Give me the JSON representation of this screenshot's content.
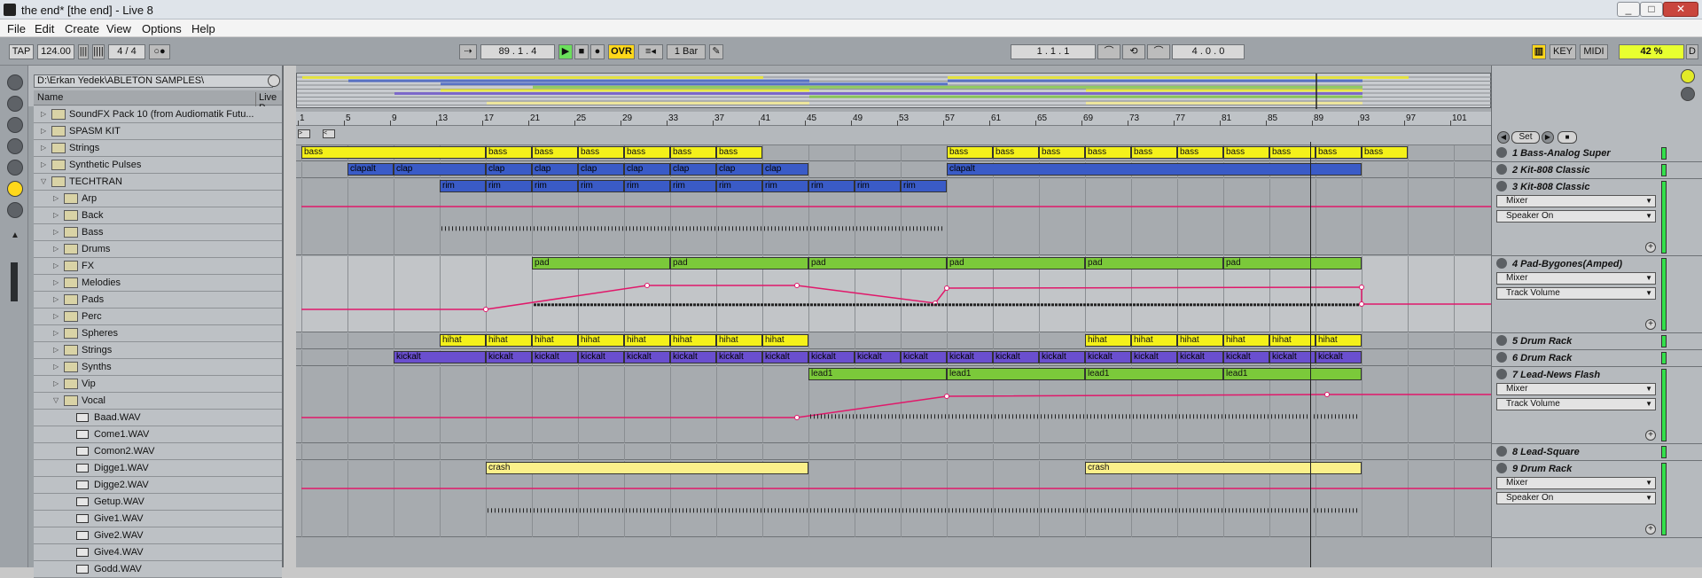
{
  "window": {
    "title": "the end*  [the end] - Live 8",
    "minimize": "_",
    "maximize": "□",
    "close": "✕"
  },
  "menu": [
    "File",
    "Edit",
    "Create",
    "View",
    "Options",
    "Help"
  ],
  "transport": {
    "tap": "TAP",
    "tempo": "124.00",
    "signature": "4 / 4",
    "follow": "○●",
    "position": "89 . 1 . 4",
    "ovr": "OVR",
    "quantize": "1 Bar",
    "loop_start": "1 . 1 . 1",
    "loop_length": "4 . 0 . 0",
    "key": "KEY",
    "midi": "MIDI",
    "cpu": "42 %",
    "d": "D"
  },
  "browser": {
    "path": "D:\\Erkan Yedek\\ABLETON SAMPLES\\",
    "col_name": "Name",
    "col_live": "Live P",
    "items": [
      {
        "label": "SoundFX Pack 10 (from Audiomatik Futu...",
        "indent": 1,
        "type": "folder",
        "open": false
      },
      {
        "label": "SPASM KIT",
        "indent": 1,
        "type": "folder",
        "open": false
      },
      {
        "label": "Strings",
        "indent": 1,
        "type": "folder",
        "open": false
      },
      {
        "label": "Synthetic Pulses",
        "indent": 1,
        "type": "folder",
        "open": false
      },
      {
        "label": "TECHTRAN",
        "indent": 1,
        "type": "folder",
        "open": true
      },
      {
        "label": "Arp",
        "indent": 2,
        "type": "folder",
        "open": false
      },
      {
        "label": "Back",
        "indent": 2,
        "type": "folder",
        "open": false
      },
      {
        "label": "Bass",
        "indent": 2,
        "type": "folder",
        "open": false
      },
      {
        "label": "Drums",
        "indent": 2,
        "type": "folder",
        "open": false
      },
      {
        "label": "FX",
        "indent": 2,
        "type": "folder",
        "open": false
      },
      {
        "label": "Melodies",
        "indent": 2,
        "type": "folder",
        "open": false
      },
      {
        "label": "Pads",
        "indent": 2,
        "type": "folder",
        "open": false
      },
      {
        "label": "Perc",
        "indent": 2,
        "type": "folder",
        "open": false
      },
      {
        "label": "Spheres",
        "indent": 2,
        "type": "folder",
        "open": false
      },
      {
        "label": "Strings",
        "indent": 2,
        "type": "folder",
        "open": false
      },
      {
        "label": "Synths",
        "indent": 2,
        "type": "folder",
        "open": false
      },
      {
        "label": "Vip",
        "indent": 2,
        "type": "folder",
        "open": false
      },
      {
        "label": "Vocal",
        "indent": 2,
        "type": "folder",
        "open": true
      },
      {
        "label": "Baad.WAV",
        "indent": 3,
        "type": "wav"
      },
      {
        "label": "Come1.WAV",
        "indent": 3,
        "type": "wav"
      },
      {
        "label": "Comon2.WAV",
        "indent": 3,
        "type": "wav"
      },
      {
        "label": "Digge1.WAV",
        "indent": 3,
        "type": "wav"
      },
      {
        "label": "Digge2.WAV",
        "indent": 3,
        "type": "wav"
      },
      {
        "label": "Getup.WAV",
        "indent": 3,
        "type": "wav"
      },
      {
        "label": "Give1.WAV",
        "indent": 3,
        "type": "wav"
      },
      {
        "label": "Give2.WAV",
        "indent": 3,
        "type": "wav"
      },
      {
        "label": "Give4.WAV",
        "indent": 3,
        "type": "wav"
      },
      {
        "label": "Godd.WAV",
        "indent": 3,
        "type": "wav"
      }
    ]
  },
  "ruler": [
    "1",
    "5",
    "9",
    "13",
    "17",
    "21",
    "25",
    "29",
    "33",
    "37",
    "41",
    "45",
    "49",
    "53",
    "57",
    "61",
    "65",
    "69",
    "73",
    "77",
    "81",
    "85",
    "89",
    "93",
    "97",
    "101"
  ],
  "locator": {
    "set": "Set"
  },
  "tracks": [
    {
      "name": "1 Bass-Analog Super",
      "color": "#f4f11a",
      "clips": [
        {
          "s": 1,
          "e": 17,
          "t": "bass"
        },
        {
          "s": 17,
          "e": 21,
          "t": "bass"
        },
        {
          "s": 21,
          "e": 25,
          "t": "bass"
        },
        {
          "s": 25,
          "e": 29,
          "t": "bass"
        },
        {
          "s": 29,
          "e": 33,
          "t": "bass"
        },
        {
          "s": 33,
          "e": 37,
          "t": "bass"
        },
        {
          "s": 37,
          "e": 41,
          "t": "bass"
        },
        {
          "s": 57,
          "e": 61,
          "t": "bass"
        },
        {
          "s": 61,
          "e": 65,
          "t": "bass"
        },
        {
          "s": 65,
          "e": 69,
          "t": "bass"
        },
        {
          "s": 69,
          "e": 73,
          "t": "bass"
        },
        {
          "s": 73,
          "e": 77,
          "t": "bass"
        },
        {
          "s": 77,
          "e": 81,
          "t": "bass"
        },
        {
          "s": 81,
          "e": 85,
          "t": "bass"
        },
        {
          "s": 85,
          "e": 89,
          "t": "bass"
        },
        {
          "s": 89,
          "e": 93,
          "t": "bass"
        },
        {
          "s": 93,
          "e": 97,
          "t": "bass"
        }
      ]
    },
    {
      "name": "2 Kit-808 Classic",
      "color": "#3a5bc7",
      "clips": [
        {
          "s": 5,
          "e": 9,
          "t": "clapalt"
        },
        {
          "s": 9,
          "e": 17,
          "t": "clap"
        },
        {
          "s": 17,
          "e": 21,
          "t": "clap"
        },
        {
          "s": 21,
          "e": 25,
          "t": "clap"
        },
        {
          "s": 25,
          "e": 29,
          "t": "clap"
        },
        {
          "s": 29,
          "e": 33,
          "t": "clap"
        },
        {
          "s": 33,
          "e": 37,
          "t": "clap"
        },
        {
          "s": 37,
          "e": 41,
          "t": "clap"
        },
        {
          "s": 41,
          "e": 45,
          "t": "clap"
        },
        {
          "s": 57,
          "e": 93,
          "t": "clapalt"
        }
      ]
    },
    {
      "name": "3 Kit-808 Classic",
      "color": "#3a5bc7",
      "mixer": "Mixer",
      "param": "Speaker On",
      "clips": [
        {
          "s": 13,
          "e": 17,
          "t": "rim"
        },
        {
          "s": 17,
          "e": 21,
          "t": "rim"
        },
        {
          "s": 21,
          "e": 25,
          "t": "rim"
        },
        {
          "s": 25,
          "e": 29,
          "t": "rim"
        },
        {
          "s": 29,
          "e": 33,
          "t": "rim"
        },
        {
          "s": 33,
          "e": 37,
          "t": "rim"
        },
        {
          "s": 37,
          "e": 41,
          "t": "rim"
        },
        {
          "s": 41,
          "e": 45,
          "t": "rim"
        },
        {
          "s": 45,
          "e": 49,
          "t": "rim"
        },
        {
          "s": 49,
          "e": 53,
          "t": "rim"
        },
        {
          "s": 53,
          "e": 57,
          "t": "rim"
        }
      ]
    },
    {
      "name": "4 Pad-Bygones(Amped)",
      "color": "#7bc93a",
      "mixer": "Mixer",
      "param": "Track Volume",
      "clips": [
        {
          "s": 21,
          "e": 33,
          "t": "pad"
        },
        {
          "s": 33,
          "e": 45,
          "t": "pad"
        },
        {
          "s": 45,
          "e": 57,
          "t": "pad"
        },
        {
          "s": 57,
          "e": 69,
          "t": "pad"
        },
        {
          "s": 69,
          "e": 81,
          "t": "pad"
        },
        {
          "s": 81,
          "e": 93,
          "t": "pad"
        }
      ]
    },
    {
      "name": "5 Drum Rack",
      "color": "#f4f11a",
      "clips": [
        {
          "s": 13,
          "e": 17,
          "t": "hihat"
        },
        {
          "s": 17,
          "e": 21,
          "t": "hihat"
        },
        {
          "s": 21,
          "e": 25,
          "t": "hihat"
        },
        {
          "s": 25,
          "e": 29,
          "t": "hihat"
        },
        {
          "s": 29,
          "e": 33,
          "t": "hihat"
        },
        {
          "s": 33,
          "e": 37,
          "t": "hihat"
        },
        {
          "s": 37,
          "e": 41,
          "t": "hihat"
        },
        {
          "s": 41,
          "e": 45,
          "t": "hihat"
        },
        {
          "s": 69,
          "e": 73,
          "t": "hihat"
        },
        {
          "s": 73,
          "e": 77,
          "t": "hihat"
        },
        {
          "s": 77,
          "e": 81,
          "t": "hihat"
        },
        {
          "s": 81,
          "e": 85,
          "t": "hihat"
        },
        {
          "s": 85,
          "e": 89,
          "t": "hihat"
        },
        {
          "s": 89,
          "e": 93,
          "t": "hihat"
        }
      ]
    },
    {
      "name": "6 Drum Rack",
      "color": "#6a4fcf",
      "clips": [
        {
          "s": 9,
          "e": 17,
          "t": "kickalt"
        },
        {
          "s": 17,
          "e": 21,
          "t": "kickalt"
        },
        {
          "s": 21,
          "e": 25,
          "t": "kickalt"
        },
        {
          "s": 25,
          "e": 29,
          "t": "kickalt"
        },
        {
          "s": 29,
          "e": 33,
          "t": "kickalt"
        },
        {
          "s": 33,
          "e": 37,
          "t": "kickalt"
        },
        {
          "s": 37,
          "e": 41,
          "t": "kickalt"
        },
        {
          "s": 41,
          "e": 45,
          "t": "kickalt"
        },
        {
          "s": 45,
          "e": 49,
          "t": "kickalt"
        },
        {
          "s": 49,
          "e": 53,
          "t": "kickalt"
        },
        {
          "s": 53,
          "e": 57,
          "t": "kickalt"
        },
        {
          "s": 57,
          "e": 61,
          "t": "kickalt"
        },
        {
          "s": 61,
          "e": 65,
          "t": "kickalt"
        },
        {
          "s": 65,
          "e": 69,
          "t": "kickalt"
        },
        {
          "s": 69,
          "e": 73,
          "t": "kickalt"
        },
        {
          "s": 73,
          "e": 77,
          "t": "kickalt"
        },
        {
          "s": 77,
          "e": 81,
          "t": "kickalt"
        },
        {
          "s": 81,
          "e": 85,
          "t": "kickalt"
        },
        {
          "s": 85,
          "e": 89,
          "t": "kickalt"
        },
        {
          "s": 89,
          "e": 93,
          "t": "kickalt"
        }
      ]
    },
    {
      "name": "7 Lead-News Flash",
      "color": "#7bc93a",
      "mixer": "Mixer",
      "param": "Track Volume",
      "clips": [
        {
          "s": 45,
          "e": 57,
          "t": "lead1"
        },
        {
          "s": 57,
          "e": 69,
          "t": "lead1"
        },
        {
          "s": 69,
          "e": 81,
          "t": "lead1"
        },
        {
          "s": 81,
          "e": 93,
          "t": "lead1"
        }
      ]
    },
    {
      "name": "8 Lead-Square",
      "color": "#f4f11a",
      "clips": []
    },
    {
      "name": "9 Drum Rack",
      "color": "#fbf08a",
      "mixer": "Mixer",
      "param": "Speaker On",
      "clips": [
        {
          "s": 17,
          "e": 45,
          "t": "crash"
        },
        {
          "s": 69,
          "e": 93,
          "t": "crash"
        }
      ]
    }
  ]
}
